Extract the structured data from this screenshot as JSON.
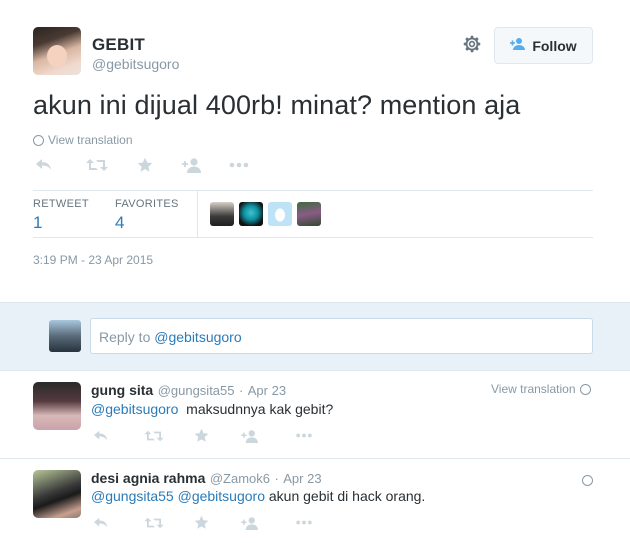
{
  "tweet": {
    "author_name": "GEBIT",
    "author_handle": "@gebitsugoro",
    "follow_label": "Follow",
    "text": "akun ini dijual 400rb! minat? mention aja",
    "view_translation": "View translation",
    "retweet_label": "RETWEET",
    "retweet_count": "1",
    "favorites_label": "FAVORITES",
    "favorites_count": "4",
    "timestamp": "3:19 PM - 23 Apr 2015"
  },
  "reply_box": {
    "prefix": "Reply to ",
    "mention": "@gebitsugoro"
  },
  "replies": [
    {
      "name": "gung sita",
      "handle": "@gungsita55",
      "date": "Apr 23",
      "view_translation": "View translation",
      "mentions": "@gebitsugoro",
      "text": "  maksudnnya kak gebit?"
    },
    {
      "name": "desi agnia rahma",
      "handle": "@Zamok6",
      "date": "Apr 23",
      "mentions": "@gungsita55 @gebitsugoro",
      "text": " akun gebit di hack orang."
    }
  ],
  "icons": {
    "reply": "reply-icon",
    "retweet": "retweet-icon",
    "favorite": "star-icon",
    "follow": "add-user-icon",
    "more": "more-icon",
    "settings": "gear-icon",
    "globe": "globe-icon"
  },
  "colors": {
    "link": "#2b7bb9",
    "muted": "#8899a6",
    "action_icon": "#ccd6dd",
    "accent": "#55acee"
  }
}
